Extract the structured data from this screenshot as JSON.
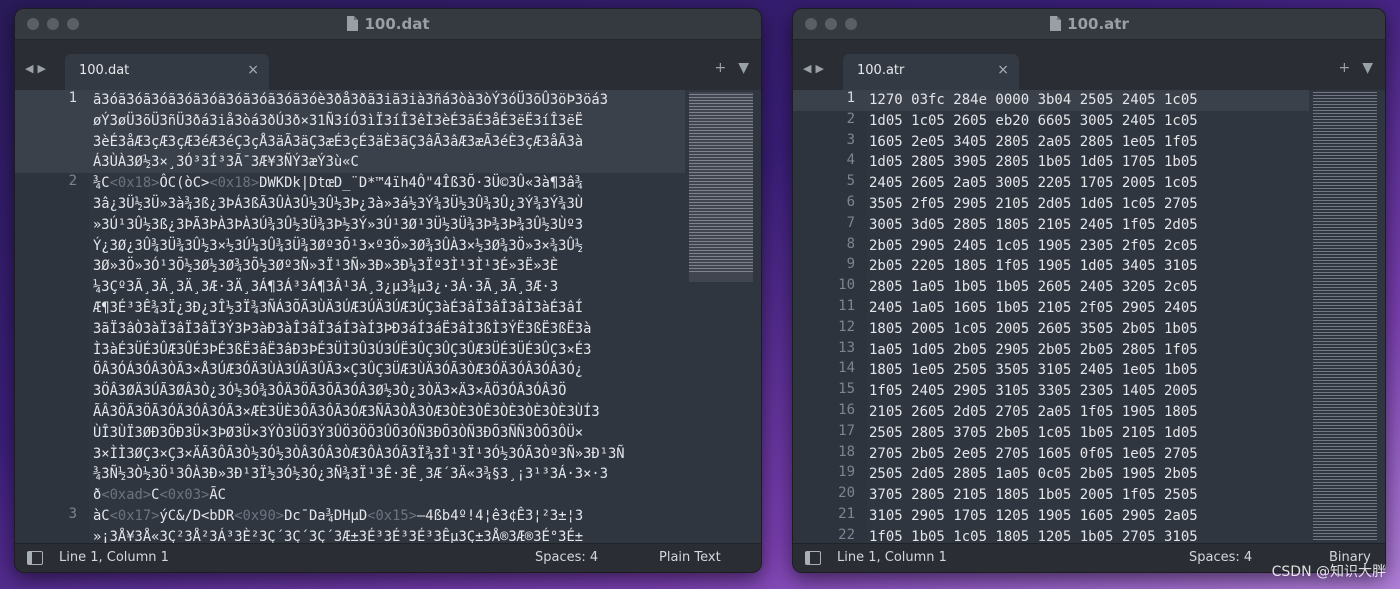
{
  "windows": [
    {
      "title": "100.dat",
      "tab_label": "100.dat",
      "tab_close": "×",
      "status": {
        "position": "Line 1, Column 1",
        "spaces": "Spaces: 4",
        "syntax": "Plain Text"
      },
      "lines": [
        {
          "number": "1",
          "rows": [
            "ã3óã3óã3óã3óã3óã3óã3óã3óã3óè3ðå3ðã3iã3ià3ñá3òà3òÝ3óÜ3õÛ3öÞ3öá3",
            "øÝ3øÜ3õÜ3ñÜ3ðá3iå3òá3ðÚ3ð×31Ñ3íÓ3ìÏ3íÎ3êÌ3èÉ3ãÉ3åÉ3ëË3íÎ3ëË",
            "3èÉ3åÆ3çÆ3çÆ3éÆ3éÇ3çÅ3äÃ3äÇ3æÉ3çÉ3äÈ3ãÇ3âÃ3âÆ3æÃ3éÈ3çÆ3åÃ3à",
            "Á3ÙÀ3Ø½3×¸3Ó³3Í³3Ã¯3Æ¥3ÑÝ3æÝ3ù«C"
          ]
        },
        {
          "number": "2",
          "rows": [
            "¾C<0x18>ÔC(òC><0x18>DWKDk|DtœD_¨D*™4ïh4Ô\"4Îß3Õ·3Ü©3Û«3à¶3â¾",
            "3â¿3Ü½3Ü»3à¾3ß¿3ÞÁ3ßÃ3ÛÀ3Û½3Û½3Þ¿3à»3á½3Ý¾3Ü½3Û¾3Û¿3Ý¾3Ý¾3Ù",
            "»3Ú¹3Û½3ß¿3ÞÃ3ÞÀ3ÞÀ3Ú¾3Û½3Ü¾3Þ½3Ý»3Ú¹3Ø¹3Ü½3Ü¾3Þ¾3Þ¾3Û½3Ùº3",
            "Ý¿3Ø¿3Û¾3Ü¾3Û½3×½3Ú¼3Û¾3Ü¾3Øº3Õ¹3×º3Ö»3Ø¾3ÛÀ3×½3Ø¾3Ö»3×¾3Û½",
            "3Ø»3Ö»3Ó¹3Õ½3Ø½3Ø¾3Õ½3Øº3Ñ»3Ï¹3Ñ»3Ð»3Ð¼3Ïº3Ì¹3Ì¹3É»3Ë»3È",
            "¼3Çº3Ã¸3Ä¸3Ä¸3Æ·3Ä¸3Á¶3Á³3Á¶3Â¹3Á¸3¿µ3¾µ3¿·3Á·3Ã¸3Ã¸3Æ·3",
            "Æ¶3É³3Ê¾3Ï¿3Ð¿3Î½3Ï¾3ÑÁ3ÕÃ3ÙÄ3ÚÆ3ÚÄ3ÚÆ3ÚÇ3àÉ3âÏ3âÎ3âÌ3àÉ3âÍ",
            "3ãÏ3âÒ3àÏ3âÏ3âÏ3Ý3Þ3àÐ3àÎ3âÏ3áÍ3àÍ3ÞÐ3áÍ3áË3âÌ3ßÌ3ÝË3ßË3ßË3à",
            "Ì3àÉ3ÜÉ3ÛÆ3ÛÉ3ÞÉ3ßË3âË3âÐ3ÞÉ3ÜÌ3Û3Ú3ÚË3ÛÇ3ÛÇ3ÛÆ3ÜÉ3ÜÉ3ÛÇ3×É3",
            "ÕÂ3ÓÁ3ÓÂ3ÒÃ3×Å3ÚÆ3ÓÄ3ÙÀ3ÚÄ3ÛÃ3×Ç3ÛÇ3ÜÆ3ÙÄ3ÓÃ3ÒÆ3ÓÄ3ÓÂ3ÓÂ3Ó¿",
            "3ÖÂ3ØÄ3ÚÃ3ØÂ3Ò¿3Ó½3Ó¾3ÔÄ3ÖÃ3ÕÃ3ÓÂ3Ø½3Ò¿3ÒÄ3×Ä3×ÃÖ3ÓÂ3ÓÂ3Ö",
            "ÃÂ3ÖÃ3ÖÃ3ÓÄ3ÓÂ3ÓÃ3×ÆÈ3ÜÈ3ÔÃ3ÔÃ3ÓÆ3ÑÃ3ÒÅ3ÒÆ3ÒÈ3ÒÊ3ÒÈ3ÒÈ3ÒÈ3ÙÍ3",
            "ÙÎ3ÙÏ3ØÐ3ÕÐ3Ü×3ÞØ3Ü×3ÝÒ3ÜÕ3Ý3ÛÖ3ÖÕ3ÛÕ3ÓÑ3ÐÕ3ÒÑ3ÐÕ3ÑÑ3ÒÕ3ÔÜ×",
            "3×ÌÌ3ØÇ3×Ç3×ÄÃ3ÔÃ3Ò½3Ó½3ÒÂ3ÓÂ3ÒÆ3ÔÀ3ÓÃ3Ï¾3Î¹3Ï¹3Ó½3ÓÃ3Òº3Ñ»3Ð¹3Ñ",
            "¾3Ñ½3Ò½3Ö¹3ÔÀ3Ð»3Ð¹3Ï½3Ó½3Ó¿3Ñ¾3Ï¹3Ê·3Ê¸3Æ´3Ä«3¾§3¸¡3¹³3Á·3×·3",
            "ð<0xad>C<0x03>ÃC"
          ]
        },
        {
          "number": "3",
          "rows": [
            "àC<0x17>ýC&/D<bDR<0x90>Dc¯Da¾DHµD<0x15>—4ßb4º!4¦ê3¢Ê3¦²3±¦3",
            "»¡3Å¥3Å«3Ç²3Å²3Á³3È²3Ç´3Ç´3Ç´3Æ±3É³3É³3É³3Êµ3Ç±3Å®3Æ®3É°3É±"
          ]
        }
      ]
    },
    {
      "title": "100.atr",
      "tab_label": "100.atr",
      "tab_close": "×",
      "status": {
        "position": "Line 1, Column 1",
        "spaces": "Spaces: 4",
        "syntax": "Binary"
      },
      "lines": [
        {
          "number": "1",
          "text": "1270 03fc 284e 0000 3b04 2505 2405 1c05"
        },
        {
          "number": "2",
          "text": "1d05 1c05 2605 eb20 6605 3005 2405 1c05"
        },
        {
          "number": "3",
          "text": "1605 2e05 3405 2805 2a05 2805 1e05 1f05"
        },
        {
          "number": "4",
          "text": "1d05 2805 3905 2805 1b05 1d05 1705 1b05"
        },
        {
          "number": "5",
          "text": "2405 2605 2a05 3005 2205 1705 2005 1c05"
        },
        {
          "number": "6",
          "text": "3505 2f05 2905 2105 2d05 1d05 1c05 2705"
        },
        {
          "number": "7",
          "text": "3005 3d05 2805 1805 2105 2405 1f05 2d05"
        },
        {
          "number": "8",
          "text": "2b05 2905 2405 1c05 1905 2305 2f05 2c05"
        },
        {
          "number": "9",
          "text": "2b05 2205 1805 1f05 1905 1d05 3405 3105"
        },
        {
          "number": "10",
          "text": "2805 1a05 1b05 1b05 2605 2405 3205 2c05"
        },
        {
          "number": "11",
          "text": "2405 1a05 1605 1b05 2105 2f05 2905 2405"
        },
        {
          "number": "12",
          "text": "1805 2005 1c05 2005 2605 3505 2b05 1b05"
        },
        {
          "number": "13",
          "text": "1a05 1d05 2b05 2905 2b05 2b05 2805 1f05"
        },
        {
          "number": "14",
          "text": "1805 1e05 2505 3505 3105 2405 1e05 1b05"
        },
        {
          "number": "15",
          "text": "1f05 2405 2905 3105 3305 2305 1405 2005"
        },
        {
          "number": "16",
          "text": "2105 2605 2d05 2705 2a05 1f05 1905 1805"
        },
        {
          "number": "17",
          "text": "2505 2805 3705 2b05 1c05 1b05 2105 1d05"
        },
        {
          "number": "18",
          "text": "2705 2b05 2e05 2705 1605 0f05 1e05 2705"
        },
        {
          "number": "19",
          "text": "2505 2d05 2805 1a05 0c05 2b05 1905 2b05"
        },
        {
          "number": "20",
          "text": "3705 2805 2105 1805 1b05 2005 1f05 2505"
        },
        {
          "number": "21",
          "text": "3105 2905 1705 1205 1905 1605 2905 2a05"
        },
        {
          "number": "22",
          "text": "1f05 1b05 1c05 1805 1205 1b05 2705 3105"
        }
      ]
    }
  ],
  "watermark": "CSDN @知识大胖"
}
